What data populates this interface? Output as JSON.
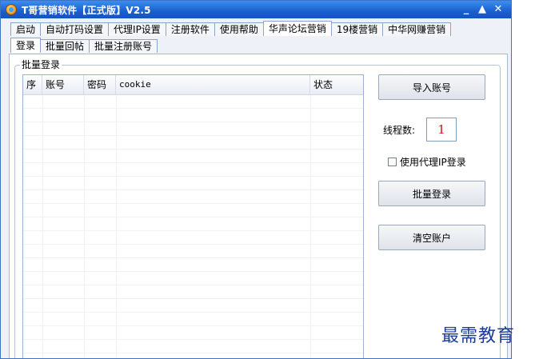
{
  "window": {
    "title": "T哥营销软件【正式版】V2.5"
  },
  "tabs_top": [
    "启动",
    "自动打码设置",
    "代理IP设置",
    "注册软件",
    "使用帮助",
    "华声论坛营销",
    "19楼营销",
    "中华网赚营销"
  ],
  "tabs_top_active": "华声论坛营销",
  "tabs_sub": [
    "登录",
    "批量回帖",
    "批量注册账号"
  ],
  "tabs_sub_active": "登录",
  "group": {
    "title": "批量登录"
  },
  "table": {
    "columns": [
      "序",
      "账号",
      "密码",
      "cookie",
      "状态"
    ],
    "rows": []
  },
  "buttons": {
    "import_accounts": "导入账号",
    "batch_login": "批量登录",
    "clear_accounts": "清空账户"
  },
  "thread": {
    "label": "线程数:",
    "value": "1"
  },
  "proxy": {
    "label": "使用代理IP登录",
    "checked": false
  },
  "watermark": "最需教育",
  "colors": {
    "titlebar": "#1a5fd0",
    "thread_value": "#d01010",
    "watermark": "#1c3b9b"
  }
}
